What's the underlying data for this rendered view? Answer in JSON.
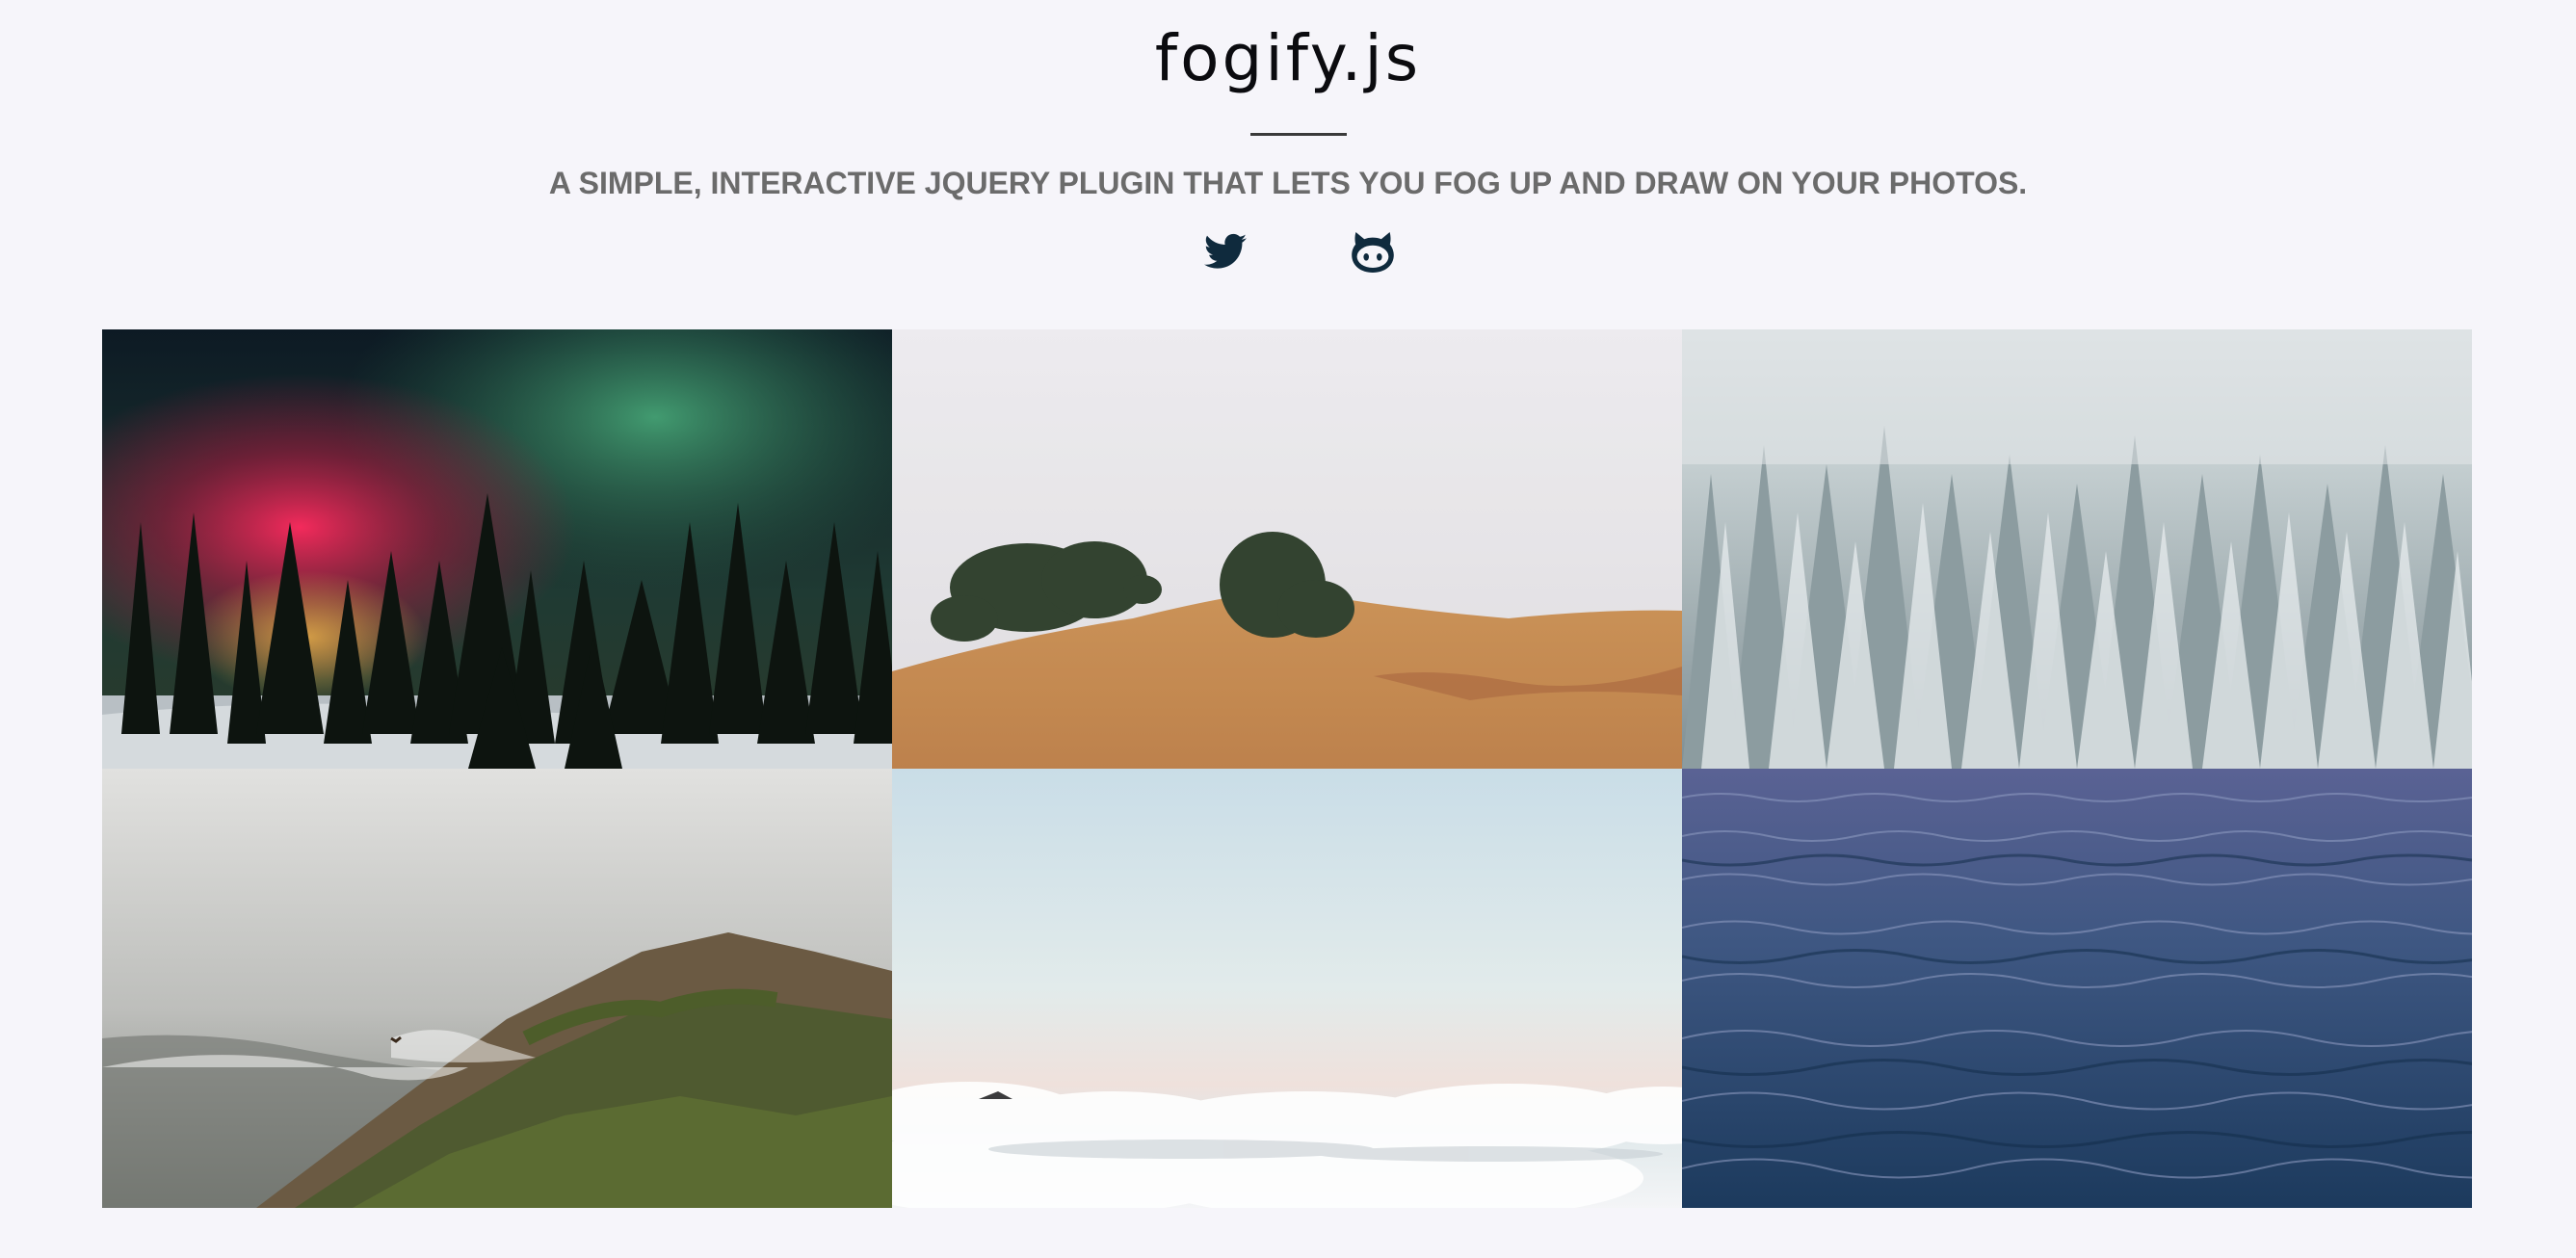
{
  "header": {
    "title": "fogify.js",
    "subtitle": "A SIMPLE, INTERACTIVE JQUERY PLUGIN THAT LETS YOU FOG UP AND DRAW ON YOUR PHOTOS."
  },
  "social": [
    {
      "icon": "twitter-icon"
    },
    {
      "icon": "github-icon"
    }
  ],
  "colors": {
    "background": "#f6f5fa",
    "icon": "#0f2a3d",
    "title": "#0b0b0f",
    "subtitle": "#6b6b6b"
  },
  "gallery": [
    {
      "subject": "aurora-forest"
    },
    {
      "subject": "misty-hillside"
    },
    {
      "subject": "snowy-forest"
    },
    {
      "subject": "foggy-cliff-bird"
    },
    {
      "subject": "sea-of-clouds"
    },
    {
      "subject": "ocean-waves"
    }
  ]
}
